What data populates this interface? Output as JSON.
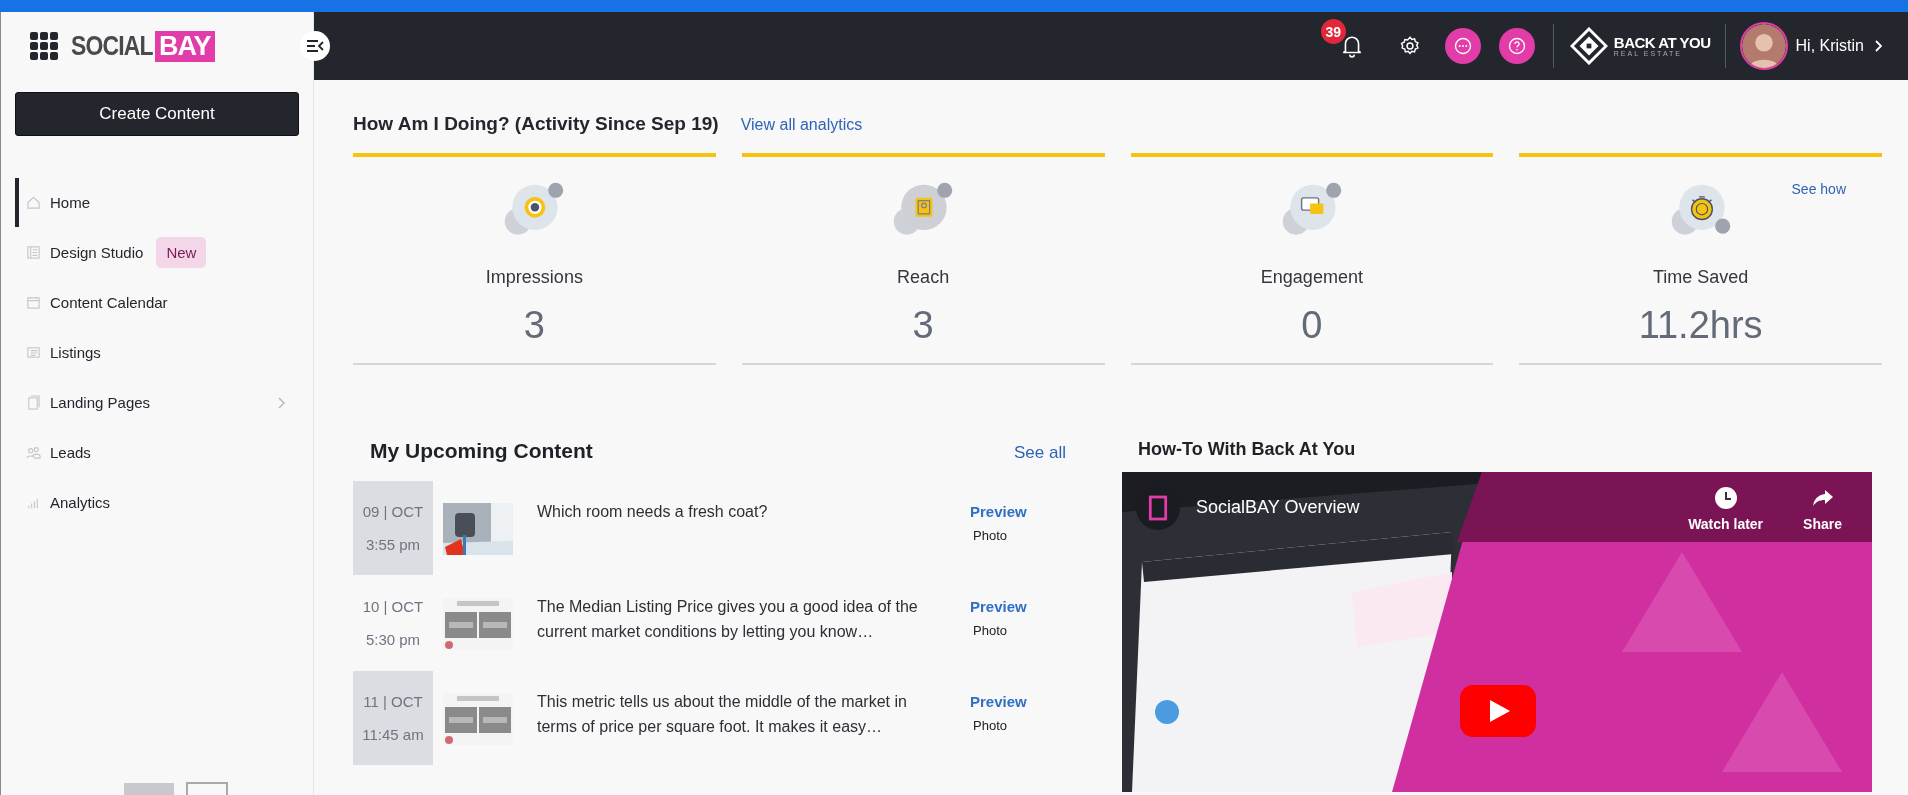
{
  "logo": {
    "word": "SOCIAL",
    "highlight": "BAY"
  },
  "header": {
    "notifications": "39",
    "brand": {
      "name": "BACK AT YOU",
      "tagline": "REAL ESTATE"
    },
    "greeting": "Hi, Kristin"
  },
  "sidebar": {
    "create_button": "Create Content",
    "items": [
      {
        "label": "Home",
        "selected": true
      },
      {
        "label": "Design Studio",
        "selected": false,
        "badge": "New"
      },
      {
        "label": "Content Calendar",
        "selected": false
      },
      {
        "label": "Listings",
        "selected": false
      },
      {
        "label": "Landing Pages",
        "selected": false,
        "has_submenu": true
      },
      {
        "label": "Leads",
        "selected": false
      },
      {
        "label": "Analytics",
        "selected": false
      }
    ]
  },
  "activity": {
    "title": "How Am I Doing? (Activity Since Sep 19)",
    "link": "View all analytics",
    "stats": [
      {
        "kind": "eye",
        "label": "Impressions",
        "value": "3"
      },
      {
        "kind": "badge",
        "label": "Reach",
        "value": "3"
      },
      {
        "kind": "chat",
        "label": "Engagement",
        "value": "0"
      },
      {
        "kind": "stopwatch",
        "label": "Time Saved",
        "value": "11.2hrs",
        "link": "See how"
      }
    ]
  },
  "upcoming": {
    "title": "My Upcoming Content",
    "link": "See all",
    "rows": [
      {
        "date": "09 | OCT",
        "time": "3:55 pm",
        "text": "Which room needs a fresh coat?",
        "action": "Preview",
        "type": "Photo"
      },
      {
        "date": "10 | OCT",
        "time": "5:30 pm",
        "text": "The Median Listing Price gives you a good idea of the current market conditions by letting you know…",
        "action": "Preview",
        "type": "Photo"
      },
      {
        "date": "11 | OCT",
        "time": "11:45 am",
        "text": "This metric tells us about the middle of the market in terms of price per square foot. It makes it easy…",
        "action": "Preview",
        "type": "Photo"
      }
    ]
  },
  "video": {
    "heading": "How-To With Back At You",
    "title": "SocialBAY Overview",
    "watch_later": "Watch later",
    "share": "Share"
  }
}
